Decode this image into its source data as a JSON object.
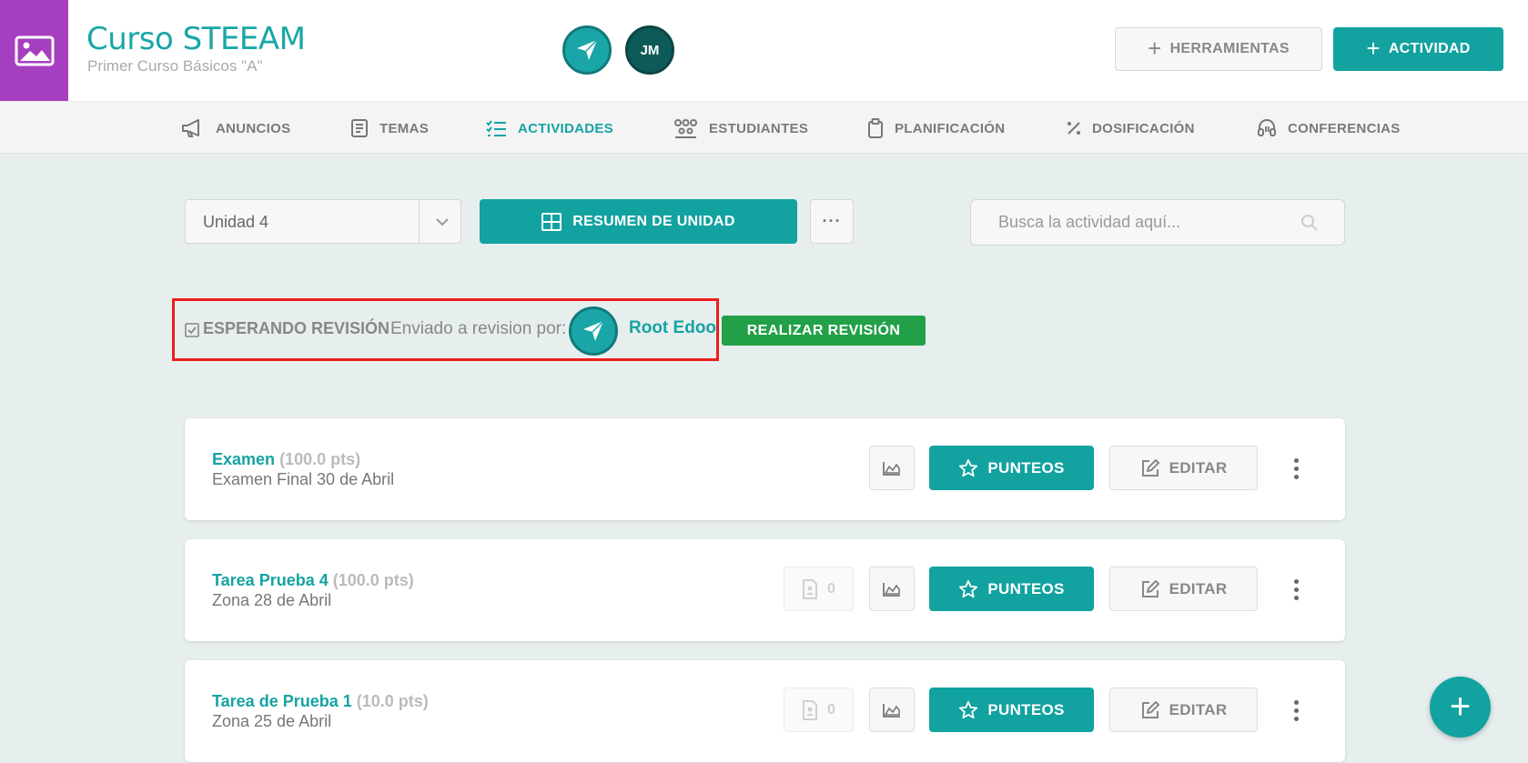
{
  "header": {
    "course_title": "Curso STEEAM",
    "course_subtitle": "Primer Curso Básicos \"A\"",
    "avatar_initials": "JM",
    "tools_label": "HERRAMIENTAS",
    "activity_label": "ACTIVIDAD",
    "brand_color": "#12a2a0",
    "logo_color": "#a63fbf"
  },
  "nav": {
    "items": [
      {
        "label": "ANUNCIOS",
        "icon": "megaphone-icon"
      },
      {
        "label": "TEMAS",
        "icon": "book-icon"
      },
      {
        "label": "ACTIVIDADES",
        "icon": "checklist-icon",
        "active": true
      },
      {
        "label": "ESTUDIANTES",
        "icon": "students-icon"
      },
      {
        "label": "PLANIFICACIÓN",
        "icon": "clipboard-icon"
      },
      {
        "label": "DOSIFICACIÓN",
        "icon": "percent-icon"
      },
      {
        "label": "CONFERENCIAS",
        "icon": "headset-icon"
      }
    ]
  },
  "toolbar": {
    "unit_value": "Unidad 4",
    "summary_label": "RESUMEN DE UNIDAD",
    "more_label": "···",
    "search_placeholder": "Busca la actividad aquí..."
  },
  "review": {
    "status": "ESPERANDO REVISIÓN",
    "sent_by_label": "Enviado a revision por:",
    "user": "Root Edoo",
    "action_label": "REALIZAR REVISIÓN",
    "highlight_color": "#ee1c1c",
    "action_color": "#22a047"
  },
  "activities": [
    {
      "title": "Examen",
      "points": "(100.0 pts)",
      "description": "Examen Final 30 de Abril",
      "submissions": null,
      "punteos_label": "PUNTEOS",
      "edit_label": "EDITAR"
    },
    {
      "title": "Tarea Prueba 4",
      "points": "(100.0 pts)",
      "description": "Zona 28 de Abril",
      "submissions": "0",
      "punteos_label": "PUNTEOS",
      "edit_label": "EDITAR"
    },
    {
      "title": "Tarea de Prueba 1",
      "points": "(10.0 pts)",
      "description": "Zona 25 de Abril",
      "submissions": "0",
      "punteos_label": "PUNTEOS",
      "edit_label": "EDITAR"
    }
  ],
  "fab_label": "+"
}
